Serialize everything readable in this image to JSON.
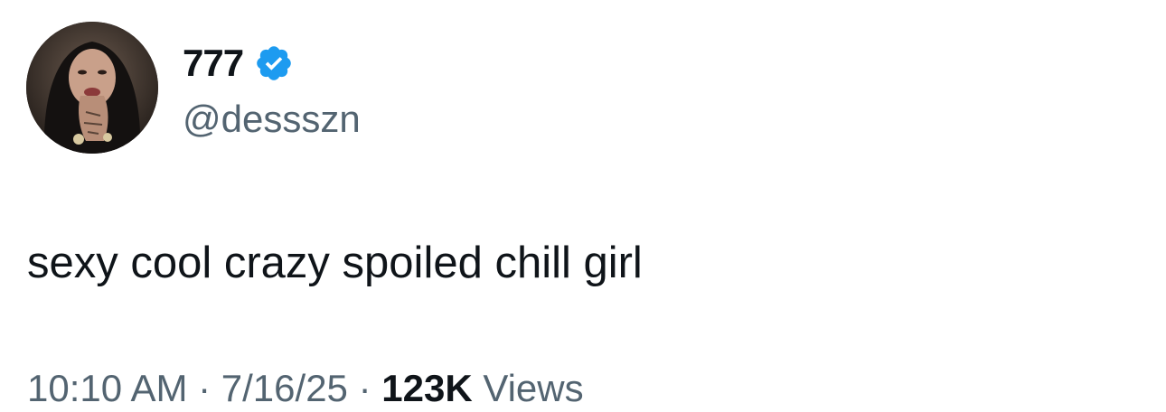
{
  "tweet": {
    "author": {
      "display_name": "777",
      "handle": "@dessszn",
      "verified": true,
      "verified_badge_color": "#1d9bf0",
      "avatar_icon": "profile-photo"
    },
    "text": "sexy cool crazy spoiled chill girl",
    "meta": {
      "time": "10:10 AM",
      "separator": "·",
      "date": "7/16/25",
      "views_count": "123K",
      "views_label": "Views"
    }
  },
  "colors": {
    "primary_text": "#0f1419",
    "secondary_text": "#536471",
    "background": "#ffffff"
  }
}
